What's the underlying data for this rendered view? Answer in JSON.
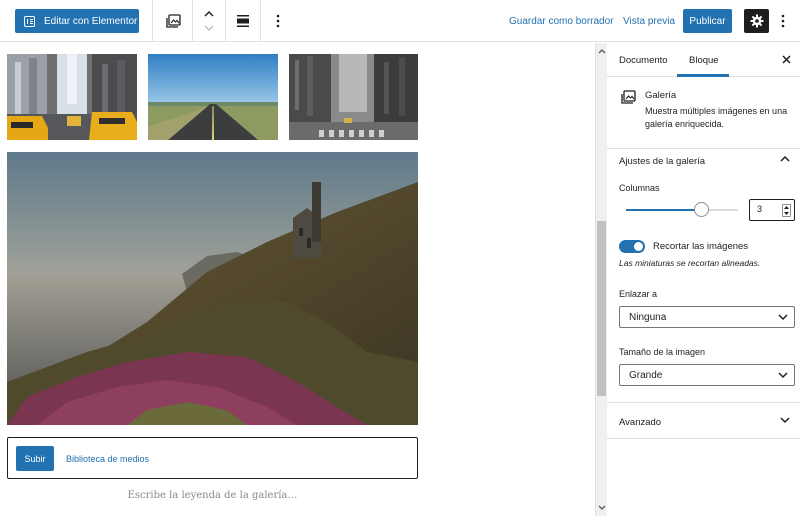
{
  "toolbar": {
    "elementor_label": "Editar con Elementor",
    "save_draft": "Guardar como borrador",
    "preview": "Vista previa",
    "publish": "Publicar"
  },
  "content": {
    "upload_button": "Subir",
    "media_library": "Biblioteca de medios",
    "caption_placeholder": "Escribe la leyenda de la galería…"
  },
  "sidebar": {
    "tabs": [
      "Documento",
      "Bloque"
    ],
    "active_tab": "Bloque",
    "block": {
      "title": "Galería",
      "description": "Muestra múltiples imágenes en una galería enriquecida."
    },
    "gallery_settings": {
      "title": "Ajustes de la galería",
      "columns_label": "Columnas",
      "columns_value": "3",
      "columns_slider_fraction": 0.67,
      "crop_label": "Recortar las imágenes",
      "crop_enabled": true,
      "crop_help": "Las miniaturas se recortan alineadas.",
      "link_label": "Enlazar a",
      "link_value": "Ninguna",
      "size_label": "Tamaño de la imagen",
      "size_value": "Grande"
    },
    "advanced": "Avanzado"
  },
  "colors": {
    "accent": "#2271b1",
    "dark": "#1e1e1e"
  }
}
